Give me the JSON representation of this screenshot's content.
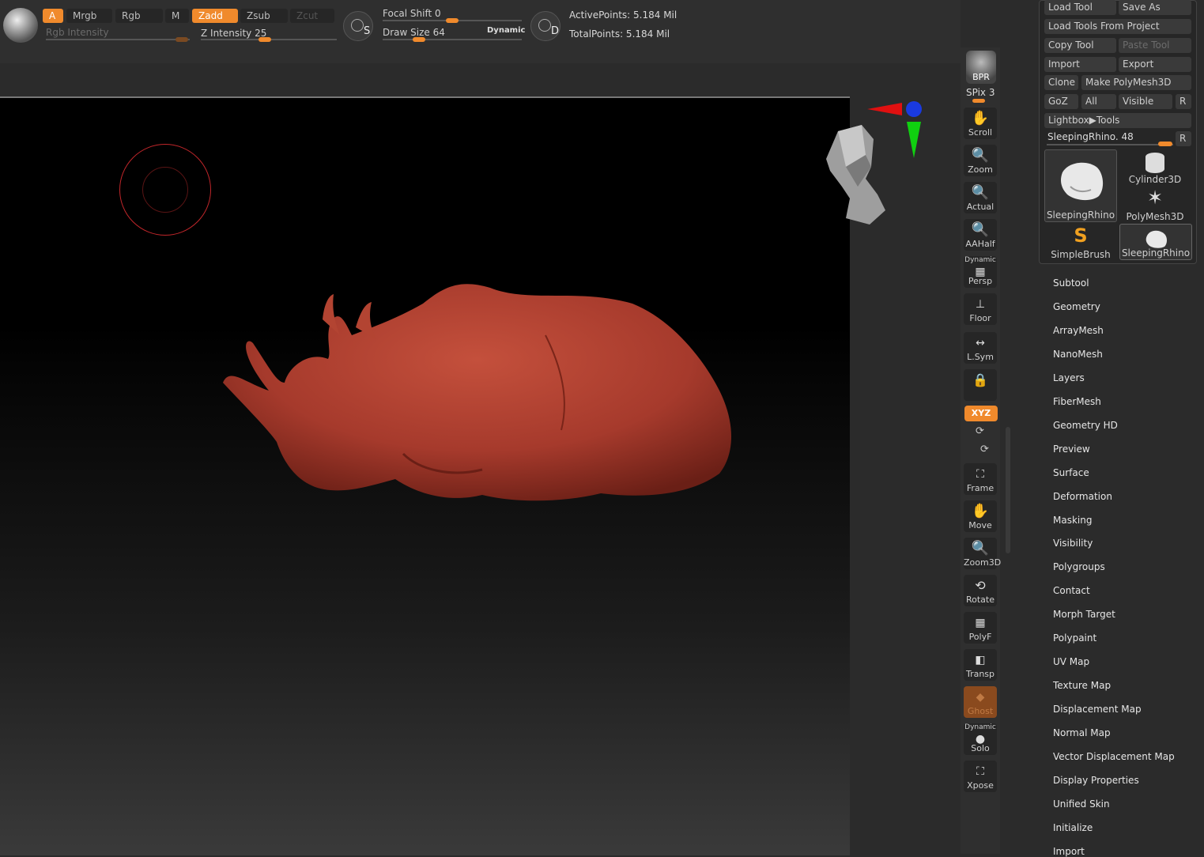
{
  "toolbar": {
    "a_label": "A",
    "mrgb_label": "Mrgb",
    "rgb_label": "Rgb",
    "m_label": "M",
    "zadd_label": "Zadd",
    "zsub_label": "Zsub",
    "zcut_label": "Zcut",
    "rgb_intensity_label": "Rgb Intensity",
    "z_intensity_label": "Z Intensity",
    "z_intensity_value": "25",
    "focal_shift_label": "Focal Shift",
    "focal_shift_value": "0",
    "draw_size_label": "Draw Size",
    "draw_size_value": "64",
    "dynamic_label": "Dynamic",
    "s_label": "S",
    "d_label": "D",
    "active_points": "ActivePoints: 5.184 Mil",
    "total_points": "TotalPoints: 5.184 Mil"
  },
  "shelf": {
    "bpr": "BPR",
    "spix_label": "SPix",
    "spix_value": "3",
    "items": [
      "Scroll",
      "Zoom",
      "Actual",
      "AAHalf",
      "Persp",
      "Floor",
      "L.Sym",
      "Frame",
      "Move",
      "Zoom3D",
      "Rotate",
      "PolyF",
      "Transp",
      "Ghost",
      "Solo",
      "Xpose"
    ],
    "dynamic_label": "Dynamic",
    "xyz_label": "XYZ"
  },
  "tool_panel": {
    "load_tool": "Load Tool",
    "save_as": "Save As",
    "load_tools_from_project": "Load Tools From Project",
    "copy_tool": "Copy Tool",
    "paste_tool": "Paste Tool",
    "import": "Import",
    "export": "Export",
    "clone": "Clone",
    "make_polymesh": "Make PolyMesh3D",
    "goz": "GoZ",
    "all": "All",
    "visible": "Visible",
    "r": "R",
    "lightbox_tools": "Lightbox▶Tools",
    "current_tool_label": "SleepingRhino.",
    "current_tool_value": "48",
    "thumbs": [
      "SleepingRhino",
      "Cylinder3D",
      "PolyMesh3D",
      "SimpleBrush",
      "SleepingRhino"
    ]
  },
  "menu": [
    "Subtool",
    "Geometry",
    "ArrayMesh",
    "NanoMesh",
    "Layers",
    "FiberMesh",
    "Geometry HD",
    "Preview",
    "Surface",
    "Deformation",
    "Masking",
    "Visibility",
    "Polygroups",
    "Contact",
    "Morph Target",
    "Polypaint",
    "UV Map",
    "Texture Map",
    "Displacement Map",
    "Normal Map",
    "Vector Displacement Map",
    "Display Properties",
    "Unified Skin",
    "Initialize",
    "Import"
  ],
  "colors": {
    "accent": "#f08a2c",
    "model": "#a63a2c",
    "brush_cursor": "#c0262a"
  }
}
